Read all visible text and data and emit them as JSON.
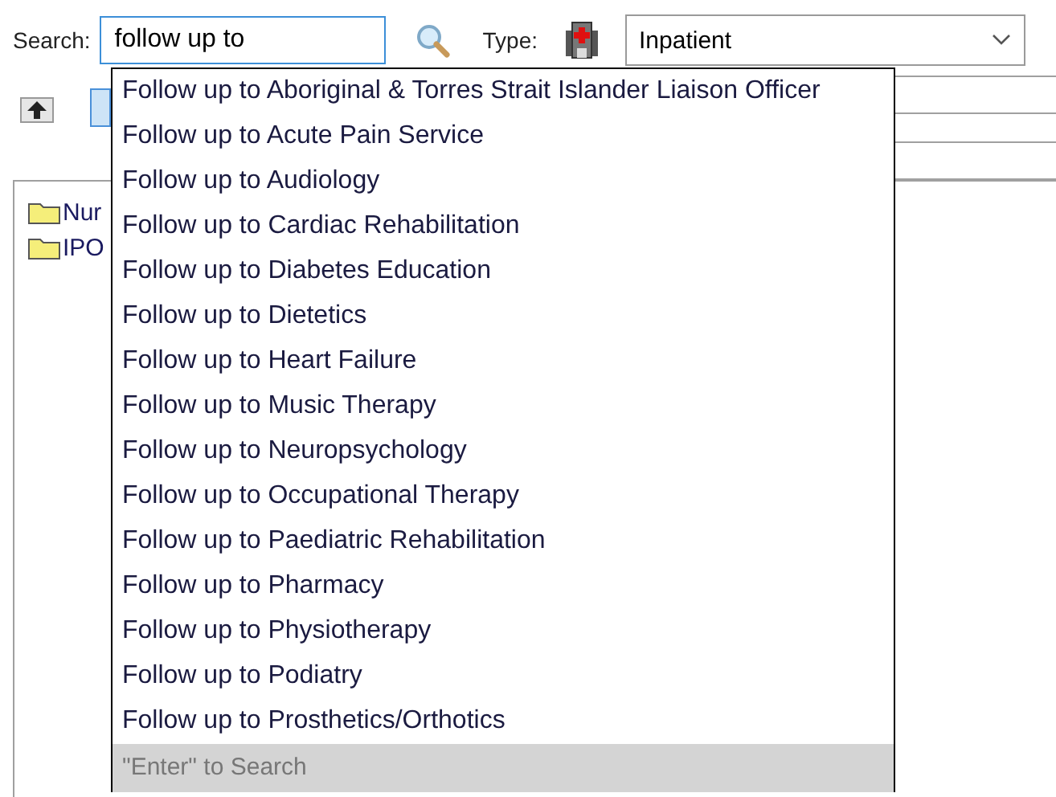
{
  "search": {
    "label": "Search:",
    "value": "follow up to"
  },
  "type": {
    "label": "Type:",
    "value": "Inpatient"
  },
  "tree": {
    "items": [
      {
        "label": "Nur"
      },
      {
        "label": "IPO"
      }
    ]
  },
  "suggestions": {
    "items": [
      "Follow up to Aboriginal & Torres Strait Islander Liaison Officer",
      "Follow up to Acute Pain Service",
      "Follow up to Audiology",
      "Follow up to Cardiac Rehabilitation",
      "Follow up to Diabetes Education",
      "Follow up to Dietetics",
      "Follow up to Heart Failure",
      "Follow up to Music Therapy",
      "Follow up to Neuropsychology",
      "Follow up to Occupational Therapy",
      "Follow up to Paediatric Rehabilitation",
      "Follow up to Pharmacy",
      "Follow up to Physiotherapy",
      "Follow up to Podiatry",
      "Follow up to Prosthetics/Orthotics"
    ],
    "footer": "\"Enter\" to Search"
  }
}
